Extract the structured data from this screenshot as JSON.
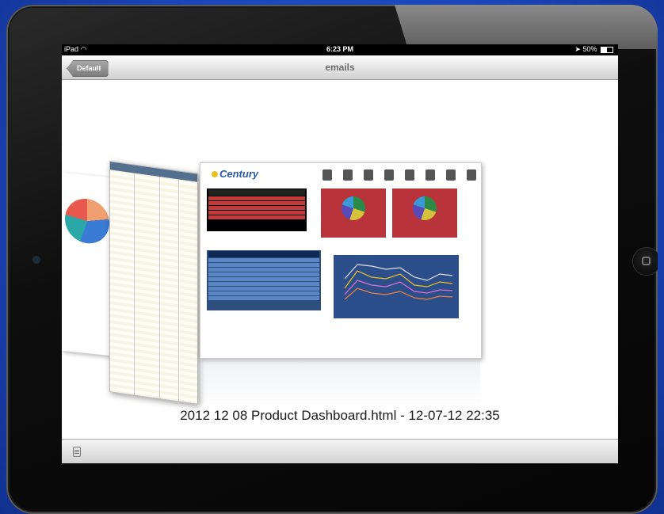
{
  "status_bar": {
    "device": "iPad",
    "time": "6:23 PM",
    "battery": "50%"
  },
  "nav": {
    "back_label": "Default",
    "title": "emails"
  },
  "preview": {
    "brand": "Century",
    "caption": "2012 12 08 Product Dashboard.html - 12-07-12 22:35"
  },
  "icons": [
    "wifi-icon",
    "location-arrow-icon",
    "battery-icon",
    "document-icon",
    "home-button-icon"
  ]
}
